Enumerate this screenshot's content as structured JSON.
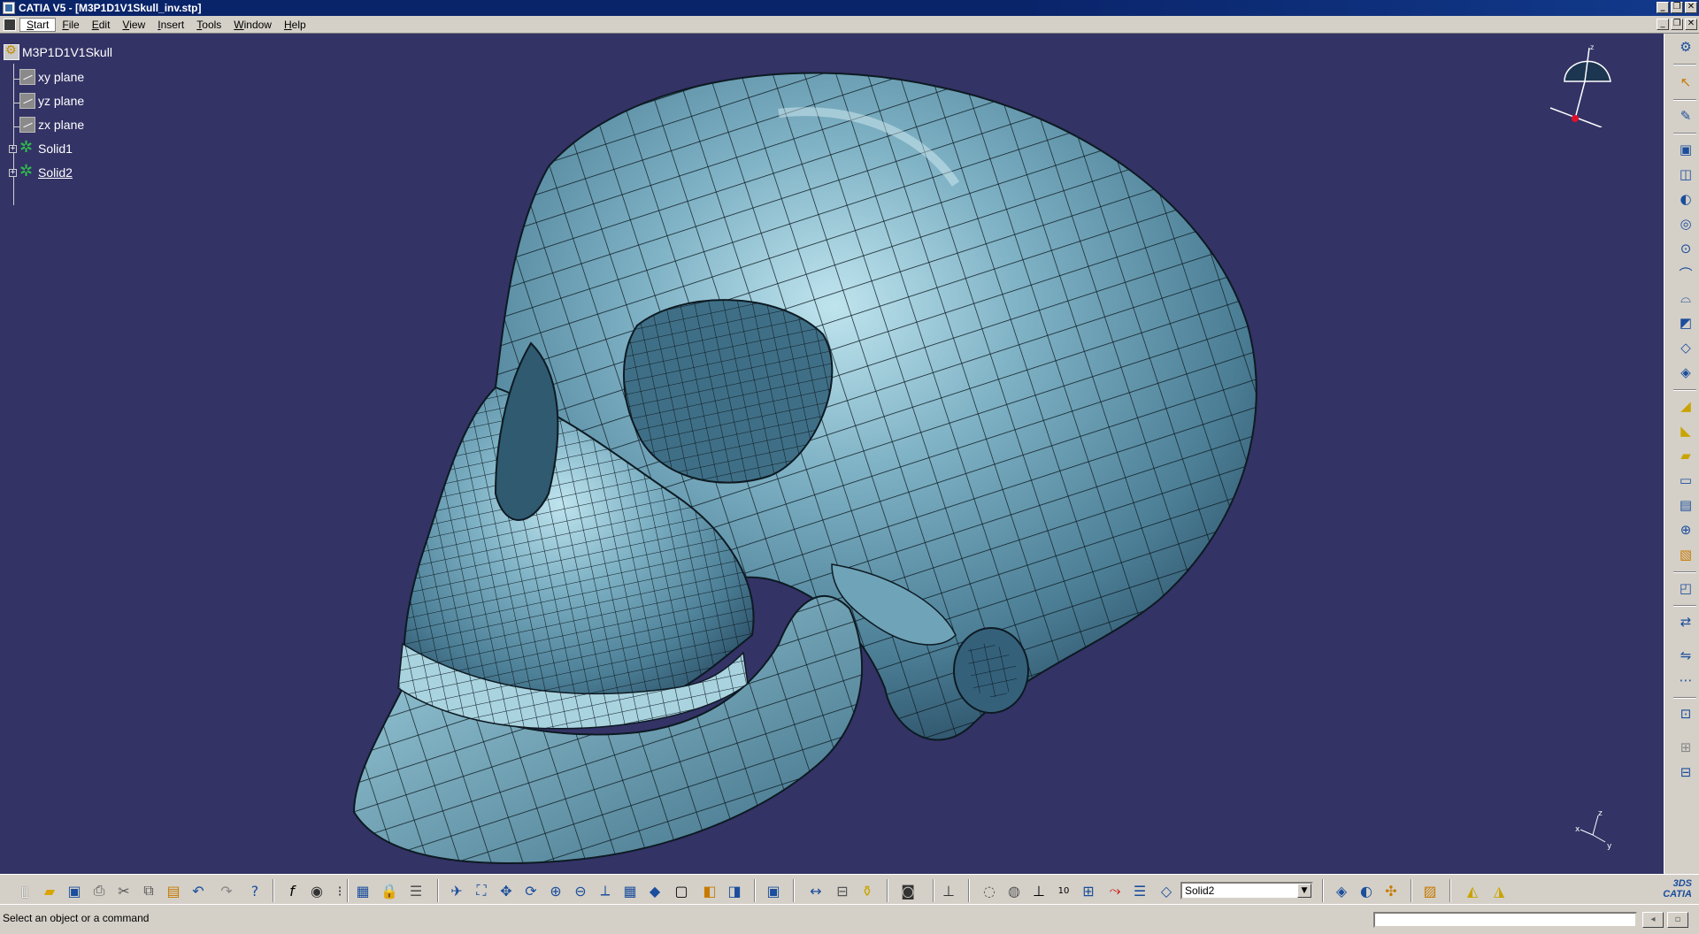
{
  "window": {
    "title": "CATIA V5 - [M3P1D1V1Skull_inv.stp]",
    "controls": [
      "minimize-icon",
      "restore-icon",
      "close-icon"
    ]
  },
  "menu": {
    "items": [
      "Start",
      "File",
      "Edit",
      "View",
      "Insert",
      "Tools",
      "Window",
      "Help"
    ],
    "active": "Start"
  },
  "tree": {
    "root": "M3P1D1V1Skull",
    "children": [
      {
        "label": "xy plane",
        "icon": "plane-icon"
      },
      {
        "label": "yz plane",
        "icon": "plane-icon"
      },
      {
        "label": "zx plane",
        "icon": "plane-icon"
      },
      {
        "label": "Solid1",
        "icon": "solid-icon"
      },
      {
        "label": "Solid2",
        "icon": "solid-icon",
        "underlined": true
      }
    ]
  },
  "viewport": {
    "background": "#333366",
    "model": "skull-mesh",
    "compass_axis": "z",
    "axis_labels": [
      "x",
      "y",
      "z"
    ]
  },
  "toolbar": {
    "layer_value": "Solid2",
    "brand": "CATIA",
    "brand_small": "3DS"
  },
  "status": {
    "message": "Select an object or a command",
    "command_input": ""
  },
  "colors": {
    "titlebar": "#0a246a",
    "background": "#333366",
    "skull": "#6fa3b8"
  }
}
